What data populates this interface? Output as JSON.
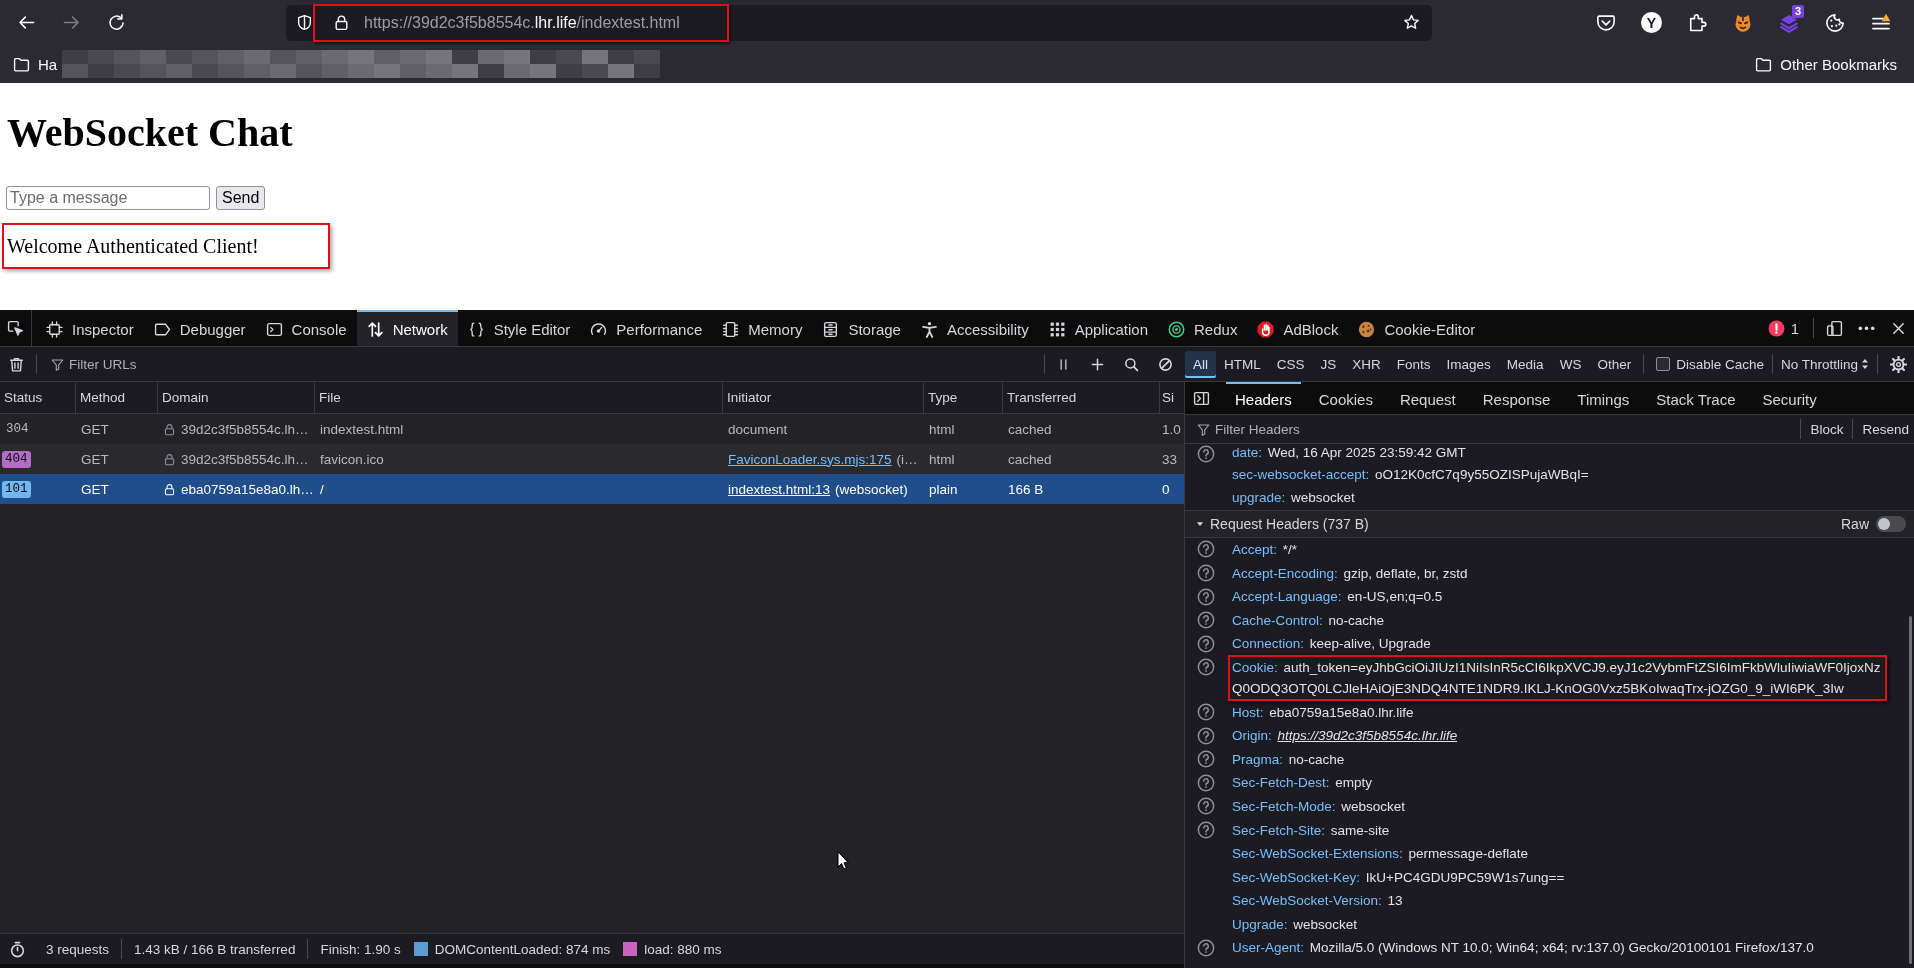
{
  "browser": {
    "nav": [
      {
        "kind": "back",
        "disabled": false
      },
      {
        "kind": "forward",
        "disabled": true
      },
      {
        "kind": "reload",
        "disabled": false
      }
    ],
    "url": {
      "parts": [
        {
          "text": "https://39d2c3f5b8554c.",
          "emphasis": false
        },
        {
          "text": "lhr.life",
          "emphasis": true
        },
        {
          "text": "/indextest.html",
          "emphasis": false
        }
      ],
      "highlighted": true
    },
    "extensions": [
      {
        "kind": "pocket"
      },
      {
        "kind": "letter",
        "label": "Y"
      },
      {
        "kind": "puzzle"
      },
      {
        "kind": "avatar"
      },
      {
        "kind": "layers",
        "badge": "3"
      },
      {
        "kind": "cookie"
      },
      {
        "kind": "menu"
      }
    ],
    "bookmarks": {
      "left": [
        {
          "label": "Ha"
        }
      ],
      "right": [
        {
          "label": "Other Bookmarks"
        }
      ]
    }
  },
  "page": {
    "title": "WebSocket Chat",
    "message_input": {
      "placeholder": "Type a message"
    },
    "send_button": "Send",
    "messages": [
      {
        "text": "Welcome Authenticated Client!",
        "highlighted": true
      }
    ]
  },
  "devtools": {
    "tabs": [
      {
        "kind": "inspector",
        "label": "Inspector",
        "selected": false
      },
      {
        "kind": "debugger",
        "label": "Debugger",
        "selected": false
      },
      {
        "kind": "console",
        "label": "Console",
        "selected": false
      },
      {
        "kind": "network",
        "label": "Network",
        "selected": true
      },
      {
        "kind": "style",
        "label": "Style Editor",
        "selected": false
      },
      {
        "kind": "performance",
        "label": "Performance",
        "selected": false
      },
      {
        "kind": "memory",
        "label": "Memory",
        "selected": false
      },
      {
        "kind": "storage",
        "label": "Storage",
        "selected": false
      },
      {
        "kind": "accessibility",
        "label": "Accessibility",
        "selected": false
      },
      {
        "kind": "application",
        "label": "Application",
        "selected": false
      },
      {
        "kind": "redux",
        "label": "Redux",
        "selected": false
      },
      {
        "kind": "adblock",
        "label": "AdBlock",
        "selected": false
      },
      {
        "kind": "cookie",
        "label": "Cookie-Editor",
        "selected": false
      }
    ],
    "error_count": "1",
    "network": {
      "filter": {
        "placeholder": "Filter URLs"
      },
      "type_filters": [
        {
          "label": "All",
          "selected": true
        },
        {
          "label": "HTML",
          "selected": false
        },
        {
          "label": "CSS",
          "selected": false
        },
        {
          "label": "JS",
          "selected": false
        },
        {
          "label": "XHR",
          "selected": false
        },
        {
          "label": "Fonts",
          "selected": false
        },
        {
          "label": "Images",
          "selected": false
        },
        {
          "label": "Media",
          "selected": false
        },
        {
          "label": "WS",
          "selected": false
        },
        {
          "label": "Other",
          "selected": false
        }
      ],
      "disable_cache": {
        "label": "Disable Cache",
        "checked": false
      },
      "throttling": {
        "label": "No Throttling"
      },
      "table": {
        "columns": [
          "Status",
          "Method",
          "Domain",
          "File",
          "Initiator",
          "Type",
          "Transferred",
          "Si"
        ],
        "rows": [
          {
            "status": {
              "code": "304"
            },
            "method": "GET",
            "secure": true,
            "domain": "39d2c3f5b8554c.lh…",
            "file": "indextest.html",
            "initiator": {
              "kind": "plain",
              "text": "document"
            },
            "type": "html",
            "transferred": "cached",
            "column_8": "1.0",
            "selected": false
          },
          {
            "status": {
              "code": "404",
              "color": "#b36cc8"
            },
            "method": "GET",
            "secure": true,
            "domain": "39d2c3f5b8554c.lh…",
            "file": "favicon.ico",
            "initiator": {
              "kind": "link",
              "link": "FaviconLoader.sys.mjs:175",
              "detail": "(i…"
            },
            "type": "html",
            "transferred": "cached",
            "column_8": "33",
            "selected": false
          },
          {
            "status": {
              "code": "101",
              "color": "#74b6ef"
            },
            "method": "GET",
            "secure": true,
            "domain": "eba0759a15e8a0.lh…",
            "file": "/",
            "initiator": {
              "kind": "link",
              "link": "indextest.html:13",
              "detail": "(websocket)"
            },
            "type": "plain",
            "transferred": "166 B",
            "column_8": "0",
            "selected": true
          }
        ]
      },
      "status_bar": [
        {
          "text": "3 requests"
        },
        {
          "text": "1.43 kB / 166 B transferred"
        },
        {
          "text": "Finish: 1.90 s"
        },
        {
          "text": "DOMContentLoaded: 874 ms",
          "color": "#5b9bd6"
        },
        {
          "text": "load: 880 ms",
          "color": "#c963c1"
        }
      ]
    },
    "sidebar": {
      "tabs": [
        {
          "label": "Headers",
          "selected": true
        },
        {
          "label": "Cookies",
          "selected": false
        },
        {
          "label": "Request",
          "selected": false
        },
        {
          "label": "Response",
          "selected": false
        },
        {
          "label": "Timings",
          "selected": false
        },
        {
          "label": "Stack Trace",
          "selected": false
        },
        {
          "label": "Security",
          "selected": false
        }
      ],
      "filter": {
        "placeholder": "Filter Headers"
      },
      "actions": [
        "Block",
        "Resend"
      ],
      "response_headers": [
        {
          "name": "date:",
          "value": "Wed, 16 Apr 2025 23:59:42 GMT",
          "kind": "text",
          "help": true
        },
        {
          "name": "sec-websocket-accept:",
          "value": "oO12K0cfC7q9y55OZISPujaWBqI=",
          "kind": "text",
          "help": false
        },
        {
          "name": "upgrade:",
          "value": "websocket",
          "kind": "text",
          "help": false
        }
      ],
      "request_section": {
        "title": "Request Headers (737 B)",
        "expanded": true,
        "raw": {
          "label": "Raw",
          "on": false
        }
      },
      "request_headers": [
        {
          "name": "Accept:",
          "value": "*/*",
          "kind": "text",
          "help": true,
          "highlighted": false
        },
        {
          "name": "Accept-Encoding:",
          "value": "gzip, deflate, br, zstd",
          "kind": "text",
          "help": true,
          "highlighted": false
        },
        {
          "name": "Accept-Language:",
          "value": "en-US,en;q=0.5",
          "kind": "text",
          "help": true,
          "highlighted": false
        },
        {
          "name": "Cache-Control:",
          "value": "no-cache",
          "kind": "text",
          "help": true,
          "highlighted": false
        },
        {
          "name": "Connection:",
          "value": "keep-alive, Upgrade",
          "kind": "text",
          "help": true,
          "highlighted": false
        },
        {
          "name": "Cookie:",
          "value": "auth_token=eyJhbGciOiJIUzI1NiIsInR5cCI6IkpXVCJ9.eyJ1c2VybmFtZSI6ImFkbWluIiwiaWF0IjoxNzQ0ODQ3OTQ0LCJleHAiOjE3NDQ4NTE1NDR9.IKLJ-KnOG0Vxz5BKoIwaqTrx-jOZG0_9_iWI6PK_3Iw",
          "kind": "text",
          "help": true,
          "highlighted": true
        },
        {
          "name": "Host:",
          "value": "eba0759a15e8a0.lhr.life",
          "kind": "text",
          "help": true,
          "highlighted": false
        },
        {
          "name": "Origin:",
          "value": "https://39d2c3f5b8554c.lhr.life",
          "kind": "link",
          "help": true,
          "highlighted": false
        },
        {
          "name": "Pragma:",
          "value": "no-cache",
          "kind": "text",
          "help": true,
          "highlighted": false
        },
        {
          "name": "Sec-Fetch-Dest:",
          "value": "empty",
          "kind": "text",
          "help": true,
          "highlighted": false
        },
        {
          "name": "Sec-Fetch-Mode:",
          "value": "websocket",
          "kind": "text",
          "help": true,
          "highlighted": false
        },
        {
          "name": "Sec-Fetch-Site:",
          "value": "same-site",
          "kind": "text",
          "help": true,
          "highlighted": false
        },
        {
          "name": "Sec-WebSocket-Extensions:",
          "value": "permessage-deflate",
          "kind": "text",
          "help": false,
          "highlighted": false
        },
        {
          "name": "Sec-WebSocket-Key:",
          "value": "IkU+PC4GDU9PC59W1s7ung==",
          "kind": "text",
          "help": false,
          "highlighted": false
        },
        {
          "name": "Sec-WebSocket-Version:",
          "value": "13",
          "kind": "text",
          "help": false,
          "highlighted": false
        },
        {
          "name": "Upgrade:",
          "value": "websocket",
          "kind": "text",
          "help": false,
          "highlighted": false
        },
        {
          "name": "User-Agent:",
          "value": "Mozilla/5.0 (Windows NT 10.0; Win64; x64; rv:137.0) Gecko/20100101 Firefox/137.0",
          "kind": "text",
          "help": true,
          "highlighted": false
        }
      ]
    }
  }
}
